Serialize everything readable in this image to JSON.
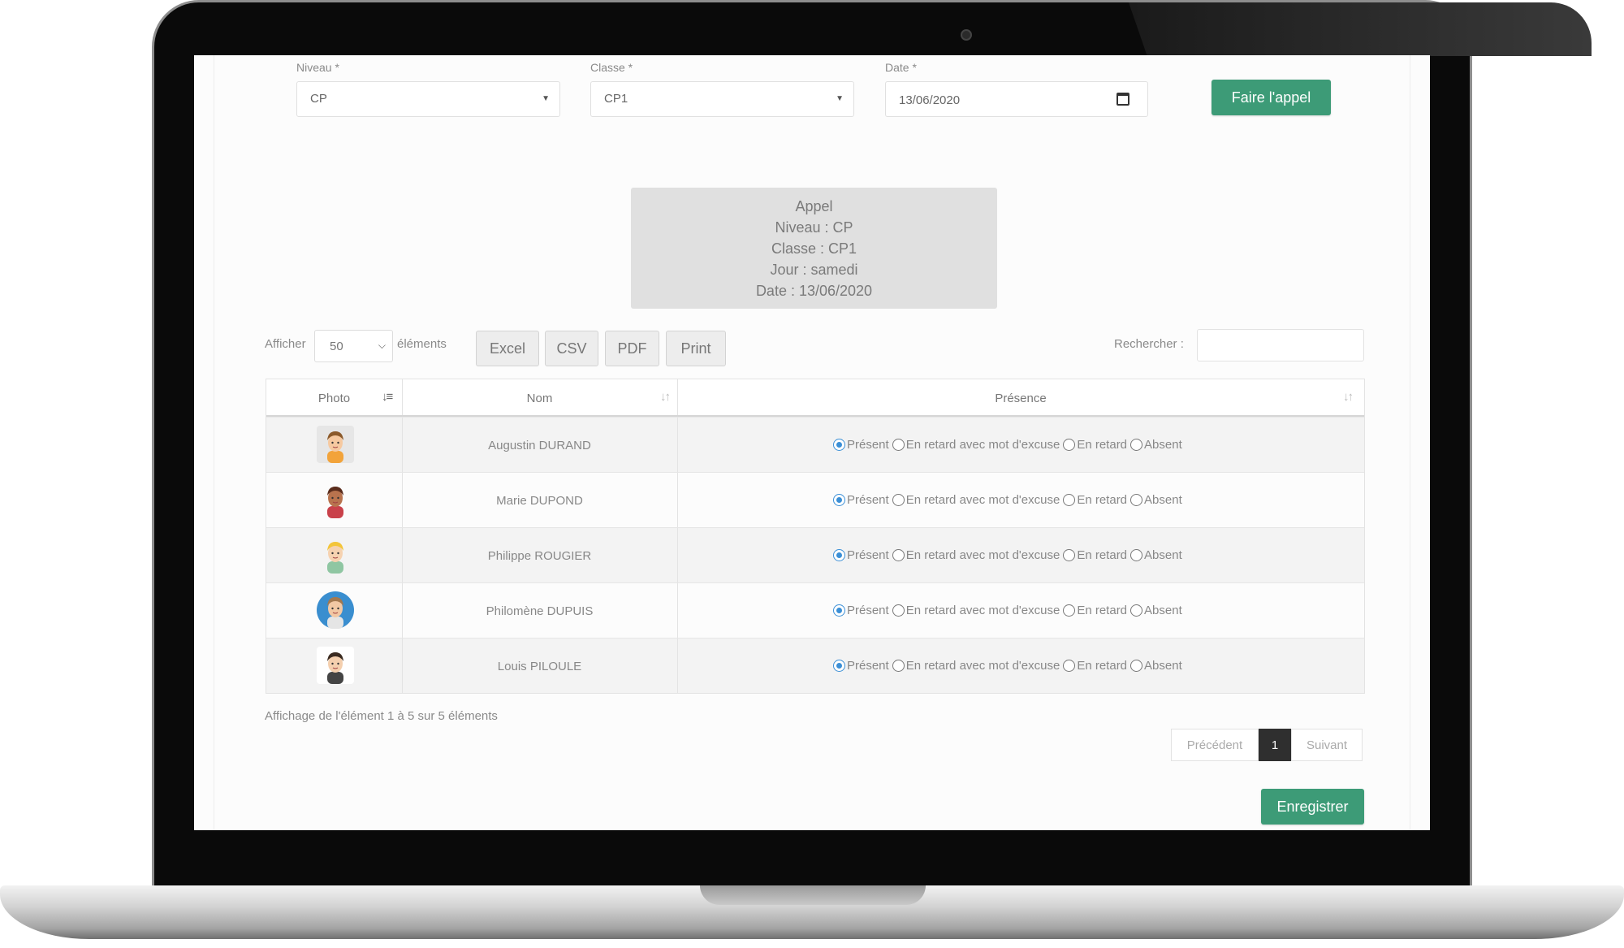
{
  "form": {
    "niveau_label": "Niveau *",
    "niveau_value": "CP",
    "classe_label": "Classe *",
    "classe_value": "CP1",
    "date_label": "Date *",
    "date_value": "13/06/2020",
    "submit_label": "Faire l'appel"
  },
  "summary": {
    "title": "Appel",
    "niveau": "Niveau : CP",
    "classe": "Classe : CP1",
    "jour": "Jour : samedi",
    "date": "Date : 13/06/2020"
  },
  "controls": {
    "show_prefix": "Afficher",
    "page_length": "50",
    "show_suffix": "éléments",
    "export_buttons": [
      "Excel",
      "CSV",
      "PDF",
      "Print"
    ],
    "search_label": "Rechercher :",
    "search_value": ""
  },
  "table": {
    "columns": [
      "Photo",
      "Nom",
      "Présence"
    ],
    "presence_options": [
      "Présent",
      "En retard avec mot d'excuse",
      "En retard",
      "Absent"
    ],
    "rows": [
      {
        "name": "Augustin DURAND",
        "avatar": "boy-avatar-icon",
        "presence": "Présent"
      },
      {
        "name": "Marie DUPOND",
        "avatar": "girl-avatar-icon",
        "presence": "Présent"
      },
      {
        "name": "Philippe ROUGIER",
        "avatar": "blond-boy-avatar-icon",
        "presence": "Présent"
      },
      {
        "name": "Philomène DUPUIS",
        "avatar": "girl-round-avatar-icon",
        "presence": "Présent"
      },
      {
        "name": "Louis PILOULE",
        "avatar": "man-avatar-icon",
        "presence": "Présent"
      }
    ]
  },
  "footer": {
    "info": "Affichage de l'élément 1 à 5 sur 5 éléments",
    "prev": "Précédent",
    "page": "1",
    "next": "Suivant",
    "save_label": "Enregistrer"
  },
  "colors": {
    "accent_green": "#3d9b77",
    "radio_blue": "#3b8fd6"
  }
}
